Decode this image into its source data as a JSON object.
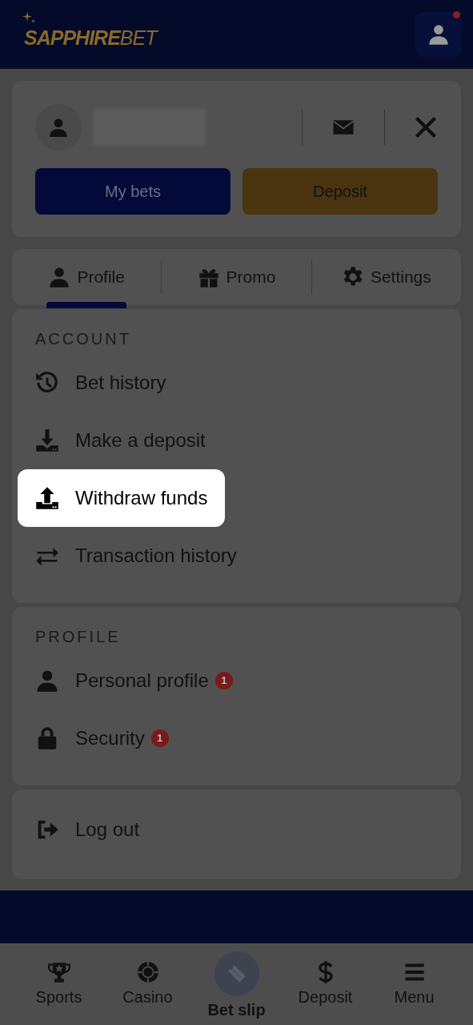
{
  "header": {
    "logo": {
      "primary": "SAPPHIRE",
      "secondary": "BET"
    },
    "user_button": {
      "notification": true
    }
  },
  "account_card": {
    "buttons": [
      {
        "label": "My bets",
        "kind": "primary"
      },
      {
        "label": "Deposit",
        "kind": "accent"
      }
    ]
  },
  "tabs": [
    {
      "label": "Profile",
      "selected": true
    },
    {
      "label": "Promo",
      "selected": false
    },
    {
      "label": "Settings",
      "selected": false
    }
  ],
  "sections": [
    {
      "title": "ACCOUNT",
      "items": [
        {
          "label": "Bet history",
          "highlighted": false
        },
        {
          "label": "Make a deposit",
          "highlighted": false
        },
        {
          "label": "Withdraw funds",
          "highlighted": true
        },
        {
          "label": "Transaction history",
          "highlighted": false
        }
      ]
    },
    {
      "title": "PROFILE",
      "items": [
        {
          "label": "Personal profile",
          "highlighted": false,
          "badge": "1"
        },
        {
          "label": "Security",
          "highlighted": false,
          "badge": "1"
        }
      ]
    },
    {
      "items": [
        {
          "label": "Log out",
          "highlighted": false
        }
      ]
    }
  ],
  "bottom_nav": [
    {
      "label": "Sports",
      "kind": "plain"
    },
    {
      "label": "Casino",
      "kind": "plain"
    },
    {
      "label": "Bet slip",
      "kind": "raised"
    },
    {
      "label": "Deposit",
      "kind": "plain"
    },
    {
      "label": "Menu",
      "kind": "plain"
    }
  ]
}
